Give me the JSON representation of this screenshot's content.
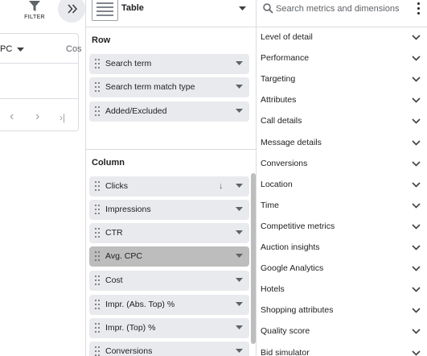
{
  "toolbar": {
    "filter_label": "FILTER"
  },
  "report": {
    "columns": [
      "PC",
      "Cos"
    ],
    "pager": {
      "prev": "‹",
      "next": "›",
      "last": "›|"
    }
  },
  "editor": {
    "visualization": "Table",
    "row_section_title": "Row",
    "rows": [
      {
        "label": "Search term"
      },
      {
        "label": "Search term match type"
      },
      {
        "label": "Added/Excluded"
      }
    ],
    "column_section_title": "Column",
    "columns": [
      {
        "label": "Clicks",
        "sorted": true,
        "sort_icon": "↓"
      },
      {
        "label": "Impressions"
      },
      {
        "label": "CTR"
      },
      {
        "label": "Avg. CPC",
        "active": true
      },
      {
        "label": "Cost"
      },
      {
        "label": "Impr. (Abs. Top) %"
      },
      {
        "label": "Impr. (Top) %"
      },
      {
        "label": "Conversions"
      }
    ]
  },
  "metrics_panel": {
    "search_placeholder": "Search metrics and dimensions",
    "categories": [
      "Level of detail",
      "Performance",
      "Targeting",
      "Attributes",
      "Call details",
      "Message details",
      "Conversions",
      "Location",
      "Time",
      "Competitive metrics",
      "Auction insights",
      "Google Analytics",
      "Hotels",
      "Shopping attributes",
      "Quality score",
      "Bid simulator"
    ]
  },
  "colors": {
    "chip_bg": "#e8eaed",
    "chip_active_bg": "#bdbdbd",
    "divider": "#dadce0",
    "text": "#202124",
    "muted": "#5f6368"
  }
}
